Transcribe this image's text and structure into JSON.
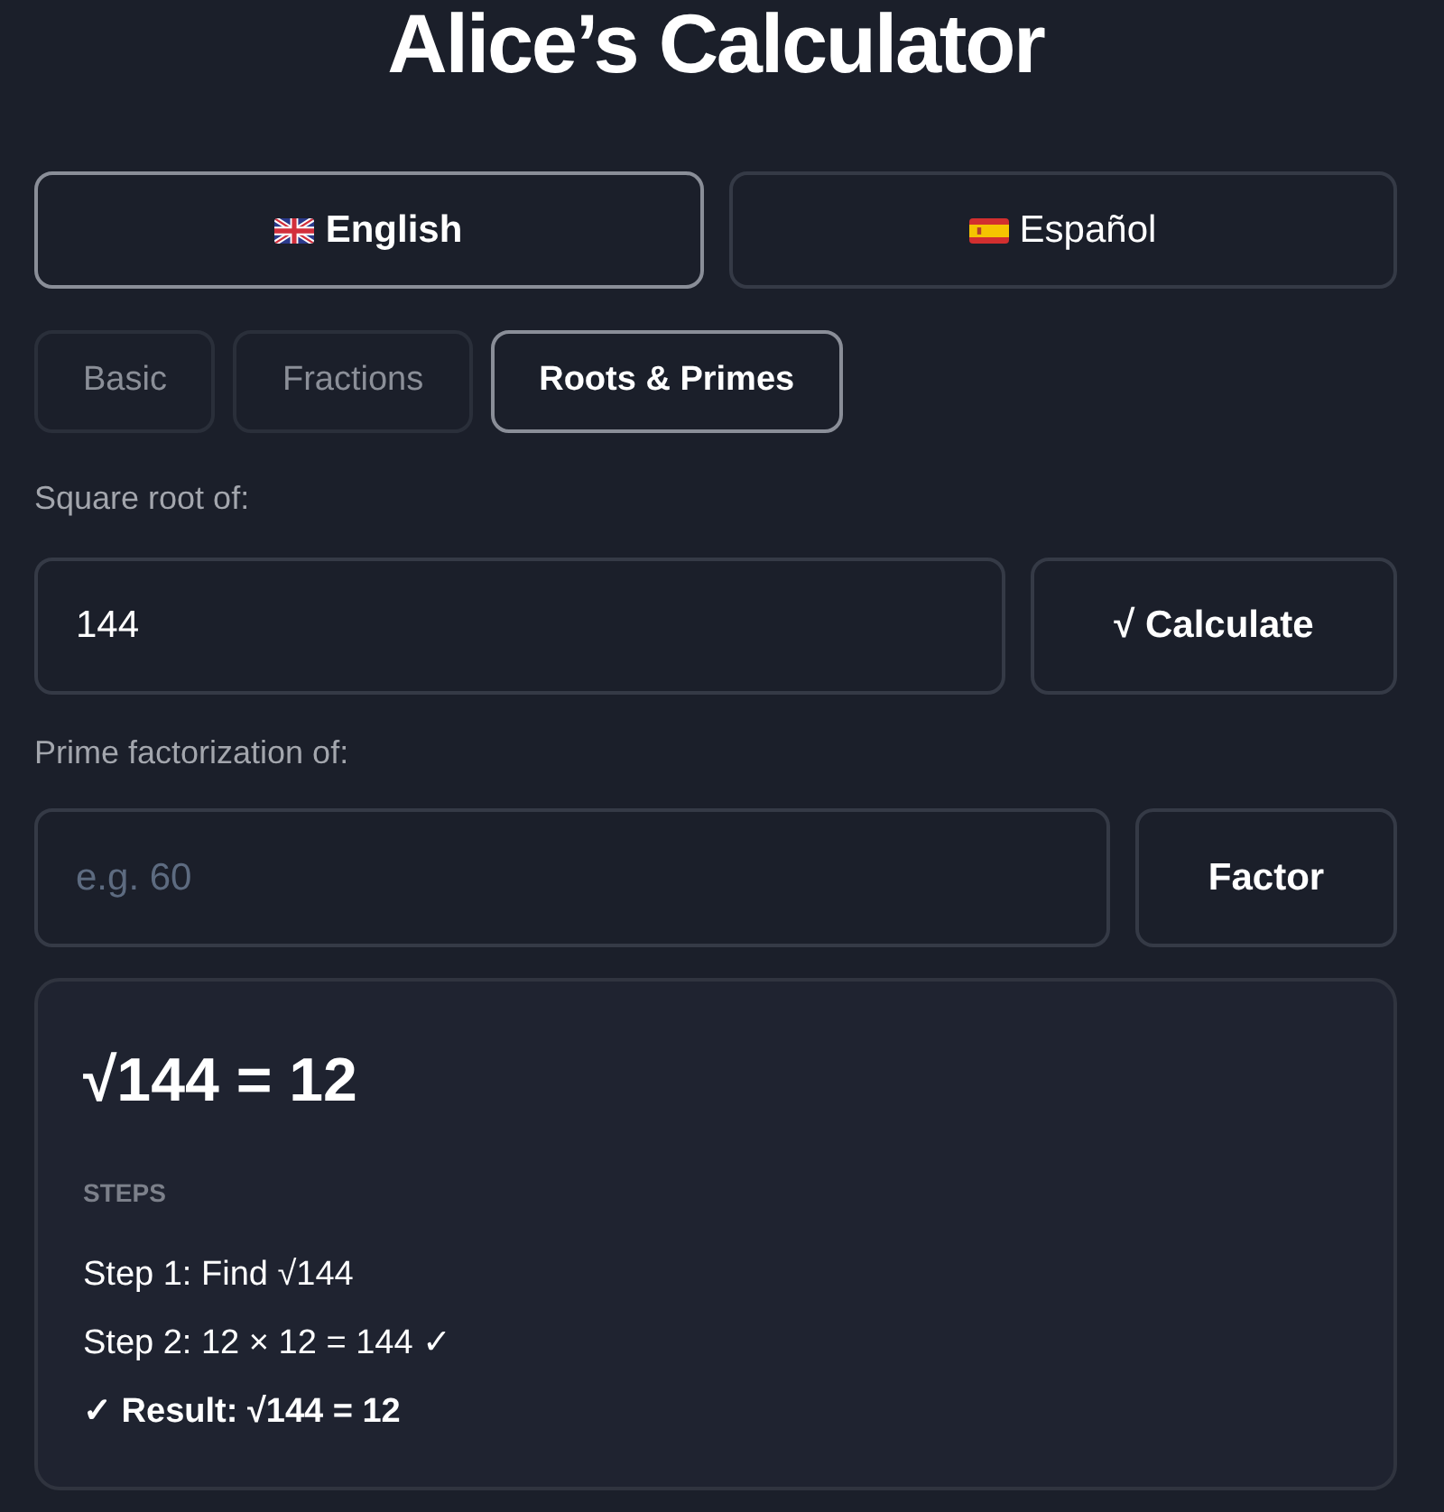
{
  "title": "Alice’s Calculator",
  "languages": [
    {
      "label": "English",
      "selected": true
    },
    {
      "label": "Español",
      "selected": false
    }
  ],
  "tabs": [
    {
      "label": "Basic",
      "selected": false
    },
    {
      "label": "Fractions",
      "selected": false
    },
    {
      "label": "Roots & Primes",
      "selected": true
    }
  ],
  "fields": [
    {
      "label": "Square root of:",
      "value": "144",
      "button": "√ Calculate"
    },
    {
      "label": "Prime factorization of:",
      "placeholder": "e.g. 60",
      "button": "Factor"
    }
  ],
  "result": {
    "heading": "√144 = 12",
    "steps_title": "STEPS",
    "steps": [
      {
        "kind": "step",
        "text": "Step 1: Find √144"
      },
      {
        "kind": "step",
        "text": "Step 2: 12 × 12 = 144 ✓"
      },
      {
        "kind": "result",
        "text": "✓ Result: √144 = 12"
      }
    ]
  }
}
